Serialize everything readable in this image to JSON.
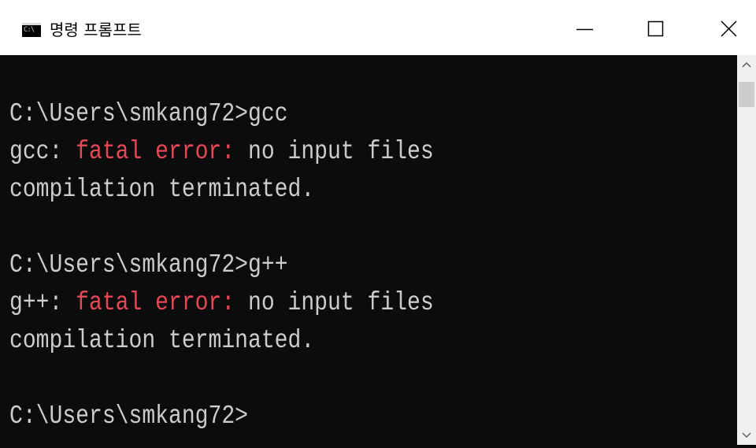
{
  "window": {
    "title": "명령 프롬프트",
    "app_icon_text": "C:\\",
    "controls": {
      "minimize": "minimize-icon",
      "maximize": "maximize-icon",
      "close": "close-icon"
    }
  },
  "console": {
    "lines": [
      {
        "segments": [
          {
            "text": ""
          }
        ]
      },
      {
        "segments": [
          {
            "text": "C:\\Users\\smkang72>gcc"
          }
        ]
      },
      {
        "segments": [
          {
            "text": "gcc: "
          },
          {
            "text": "fatal error:",
            "style": "error"
          },
          {
            "text": " no input files"
          }
        ]
      },
      {
        "segments": [
          {
            "text": "compilation terminated."
          }
        ]
      },
      {
        "segments": [
          {
            "text": ""
          }
        ]
      },
      {
        "segments": [
          {
            "text": "C:\\Users\\smkang72>g++"
          }
        ]
      },
      {
        "segments": [
          {
            "text": "g++: "
          },
          {
            "text": "fatal error:",
            "style": "error"
          },
          {
            "text": " no input files"
          }
        ]
      },
      {
        "segments": [
          {
            "text": "compilation terminated."
          }
        ]
      },
      {
        "segments": [
          {
            "text": ""
          }
        ]
      },
      {
        "segments": [
          {
            "text": "C:\\Users\\smkang72>"
          }
        ]
      }
    ]
  },
  "scrollbar": {
    "up_icon": "chevron-up-icon",
    "down_icon": "chevron-down-icon"
  },
  "colors": {
    "background": "#0c0c0c",
    "text": "#cccccc",
    "error": "#e74856",
    "titlebar": "#ffffff"
  }
}
